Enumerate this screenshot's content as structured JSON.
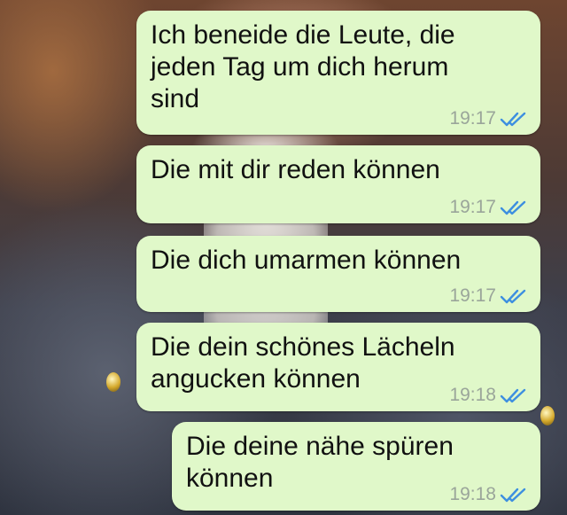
{
  "messages": [
    {
      "text": "Ich beneide die Leute, die\njeden Tag um dich herum\nsind",
      "time": "19:17",
      "status": "read"
    },
    {
      "text": "Die mit dir reden können",
      "time": "19:17",
      "status": "read"
    },
    {
      "text": "Die dich umarmen können",
      "time": "19:17",
      "status": "read"
    },
    {
      "text": "Die dein schönes Lächeln\nangucken können",
      "time": "19:18",
      "status": "read"
    },
    {
      "text": "Die deine nähe spüren\nkönnen",
      "time": "19:18",
      "status": "read"
    }
  ],
  "colors": {
    "bubble": "#e0f8c9",
    "ticks": "#3d8fe0",
    "time": "#9aa59a"
  },
  "icons": {
    "status": "double-check-icon"
  }
}
